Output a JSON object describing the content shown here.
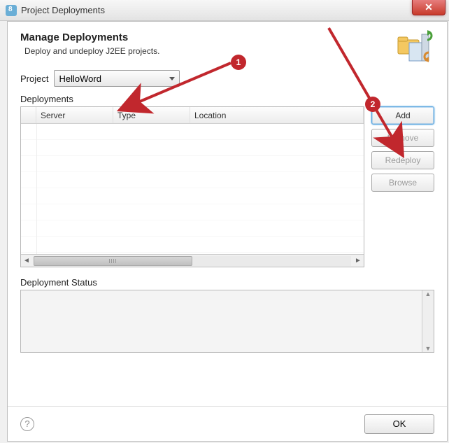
{
  "window": {
    "title": "Project Deployments"
  },
  "header": {
    "heading": "Manage Deployments",
    "subtitle": "Deploy and undeploy J2EE projects."
  },
  "project": {
    "label": "Project",
    "selected": "HelloWord"
  },
  "deployments": {
    "section_label": "Deployments",
    "columns": {
      "server": "Server",
      "type": "Type",
      "location": "Location"
    },
    "rows": []
  },
  "buttons": {
    "add": "Add",
    "remove": "Remove",
    "redeploy": "Redeploy",
    "browse": "Browse"
  },
  "status": {
    "label": "Deployment Status",
    "text": ""
  },
  "footer": {
    "ok": "OK"
  },
  "annotations": {
    "badge1": "1",
    "badge2": "2"
  }
}
